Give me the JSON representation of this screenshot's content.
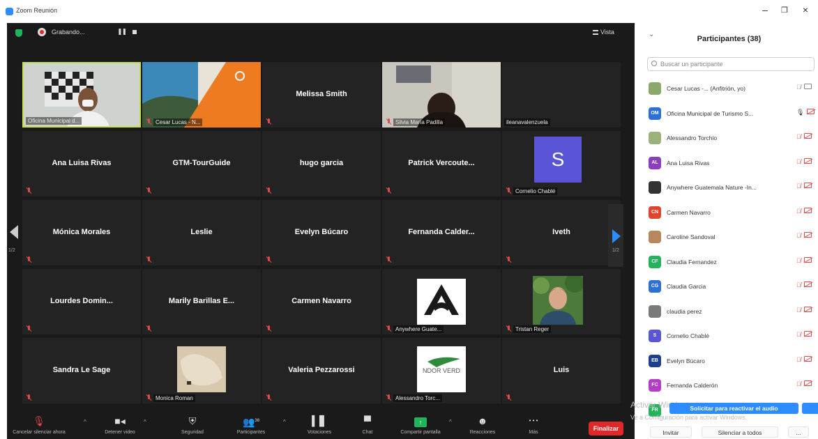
{
  "window": {
    "title": "Zoom Reunión"
  },
  "recording": {
    "label": "Grabando...",
    "pause": "❚❚"
  },
  "view": {
    "label": "Vista"
  },
  "pagination": {
    "left": "1/2",
    "right": "1/2"
  },
  "tiles": [
    {
      "label": "Oficina Municipal d...",
      "type": "video",
      "active": true,
      "mic_off": false
    },
    {
      "label": "Cesar Lucas -  N...",
      "type": "video",
      "mic_off": true
    },
    {
      "center_name": "Melissa Smith",
      "mic_off": true
    },
    {
      "label": "Silvia María Padilla",
      "type": "video",
      "mic_off": true
    },
    {
      "label": "ileanavalenzuela",
      "mic_off": false
    },
    {
      "center_name": "Ana Luisa Rivas",
      "mic_off": true
    },
    {
      "center_name": "GTM-TourGuide",
      "mic_off": true
    },
    {
      "center_name": "hugo garcia",
      "mic_off": true
    },
    {
      "center_name": "Patrick  Vercoute...",
      "mic_off": true
    },
    {
      "label": "Cornelio Chablé",
      "avatar_letter": "S",
      "mic_off": true
    },
    {
      "center_name": "Mónica Morales",
      "mic_off": true
    },
    {
      "center_name": "Leslie",
      "mic_off": true
    },
    {
      "center_name": "Evelyn Búcaro",
      "mic_off": true
    },
    {
      "center_name": "Fernanda  Calder...",
      "mic_off": true
    },
    {
      "center_name": "Iveth",
      "mic_off": true
    },
    {
      "center_name": "Lourdes  Domin...",
      "mic_off": true
    },
    {
      "center_name": "Marily Barillas E...",
      "mic_off": true
    },
    {
      "center_name": "Carmen Navarro",
      "mic_off": true
    },
    {
      "label": "Anywhere Guate...",
      "type": "logo",
      "mic_off": true
    },
    {
      "label": "Tristan Reger",
      "type": "photo",
      "mic_off": true
    },
    {
      "center_name": "Sandra Le Sage",
      "mic_off": true
    },
    {
      "label": "Monica Roman",
      "type": "photo",
      "mic_off": true
    },
    {
      "center_name": "Valeria Pezzarossi",
      "mic_off": true
    },
    {
      "label": "Alessandro Torc...",
      "type": "logo",
      "logo_text": "NDOR VERD",
      "mic_off": true
    },
    {
      "center_name": "Luis",
      "mic_off": true
    }
  ],
  "toolbar": {
    "unmute": "Cancelar silenciar ahora",
    "stop_video": "Detener video",
    "security": "Seguridad",
    "participants": "Participantes",
    "participants_count": "38",
    "polls": "Votaciones",
    "chat": "Chat",
    "share": "Compartir pantalla",
    "reactions": "Reacciones",
    "more": "Más",
    "more_glyph": "• • •",
    "end": "Finalizar"
  },
  "panel": {
    "title": "Participantes (38)",
    "search_placeholder": "Buscar un participante",
    "participants": [
      {
        "name": "Cesar Lucas -...  (Anfitrión, yo)",
        "initials": "",
        "color": "#8aa86a",
        "host": true
      },
      {
        "name": "Oficina Municipal de Turismo S...",
        "initials": "OM",
        "color": "#2d6fd2",
        "mic_on": true
      },
      {
        "name": "Alessandro Torchio",
        "initials": "",
        "color": "#9bb37a"
      },
      {
        "name": "Ana Luisa Rivas",
        "initials": "AL",
        "color": "#8b3fbf"
      },
      {
        "name": "Anywhere Guatemala Nature -In...",
        "initials": "",
        "color": "#333333"
      },
      {
        "name": "Carmen Navarro",
        "initials": "CN",
        "color": "#e0442f"
      },
      {
        "name": "Caroline Sandoval",
        "initials": "",
        "color": "#b9875d"
      },
      {
        "name": "Claudia Fernandez",
        "initials": "CF",
        "color": "#23b35a"
      },
      {
        "name": "Claudia Garcia",
        "initials": "CG",
        "color": "#2d6fd2"
      },
      {
        "name": "claudia perez",
        "initials": "",
        "color": "#7a7a7a"
      },
      {
        "name": "Cornelio Chablé",
        "initials": "S",
        "color": "#5a55d6"
      },
      {
        "name": "Evelyn Búcaro",
        "initials": "EB",
        "color": "#1f3f8f"
      },
      {
        "name": "Fernanda Calderón",
        "initials": "FC",
        "color": "#b43dc5"
      },
      {
        "name": "",
        "initials": "FR",
        "color": "#23b35a"
      }
    ],
    "reactivate_audio": "Solicitar para reactivar el audio",
    "watermark_line1": "Activar Windows",
    "watermark_line2": "Ve a Configuración para activar Windows.",
    "invite": "Invitar",
    "mute_all": "Silenciar a todos",
    "more": "..."
  },
  "colors": {
    "accent": "#2d8cff",
    "end": "#e02828",
    "active_border": "#c7e14b",
    "muted": "#e04a4a"
  }
}
